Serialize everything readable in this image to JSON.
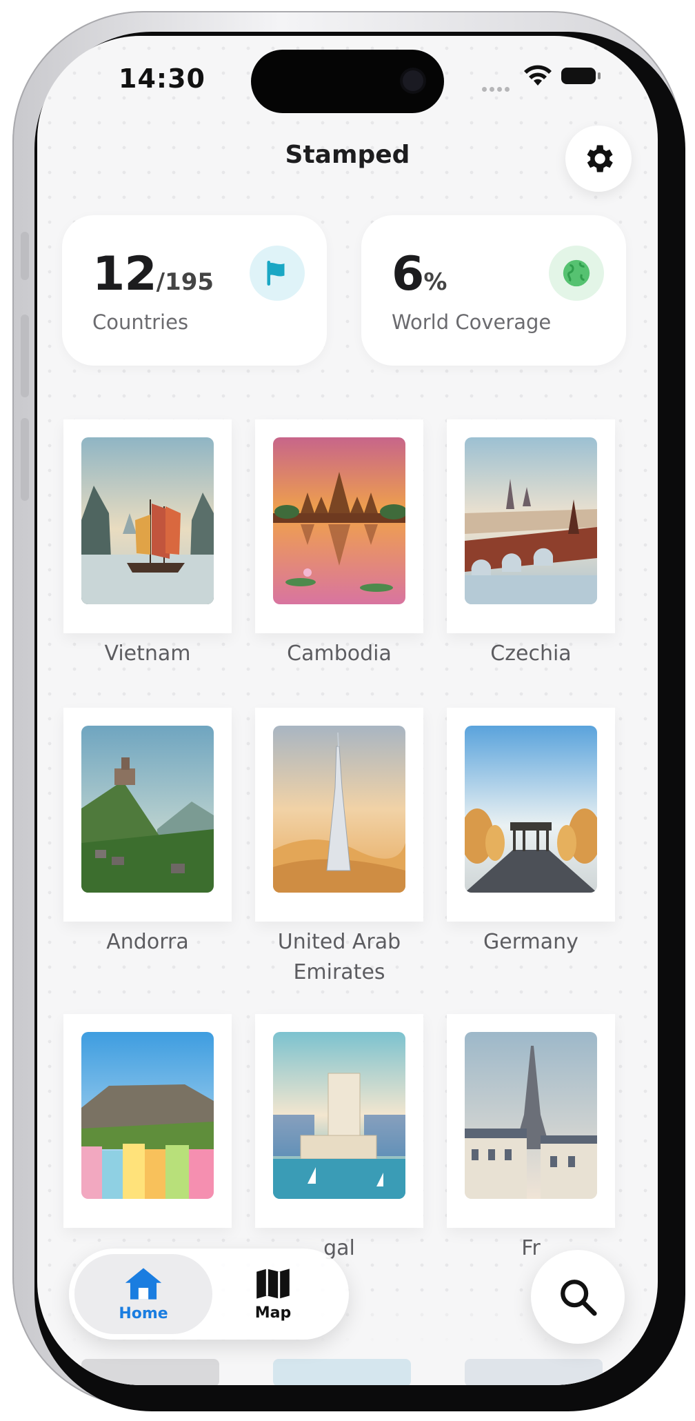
{
  "status_bar": {
    "time": "14:30"
  },
  "header": {
    "title": "Stamped"
  },
  "stats": [
    {
      "value": "12",
      "suffix": "/195",
      "label": "Countries",
      "icon": "flag-icon",
      "color": "#1aa7c4"
    },
    {
      "value": "6",
      "suffix": "%",
      "label": "World Coverage",
      "icon": "globe-icon",
      "color": "#56c271"
    }
  ],
  "stamps": [
    {
      "country": "Vietnam",
      "icon": "junk-boat-bay-illustration"
    },
    {
      "country": "Cambodia",
      "icon": "angkor-wat-illustration"
    },
    {
      "country": "Czechia",
      "icon": "charles-bridge-illustration"
    },
    {
      "country": "Andorra",
      "icon": "mountain-church-illustration"
    },
    {
      "country": "United Arab\nEmirates",
      "icon": "burj-khalifa-illustration"
    },
    {
      "country": "Germany",
      "icon": "brandenburg-gate-illustration"
    },
    {
      "country": "",
      "icon": "table-mountain-illustration"
    },
    {
      "country": "Portugal",
      "visible_text": "gal",
      "icon": "belem-tower-illustration"
    },
    {
      "country": "France",
      "visible_text": "Fr",
      "icon": "eiffel-tower-illustration"
    }
  ],
  "tabbar": {
    "home_label": "Home",
    "map_label": "Map",
    "active_color": "#1a7de0"
  }
}
